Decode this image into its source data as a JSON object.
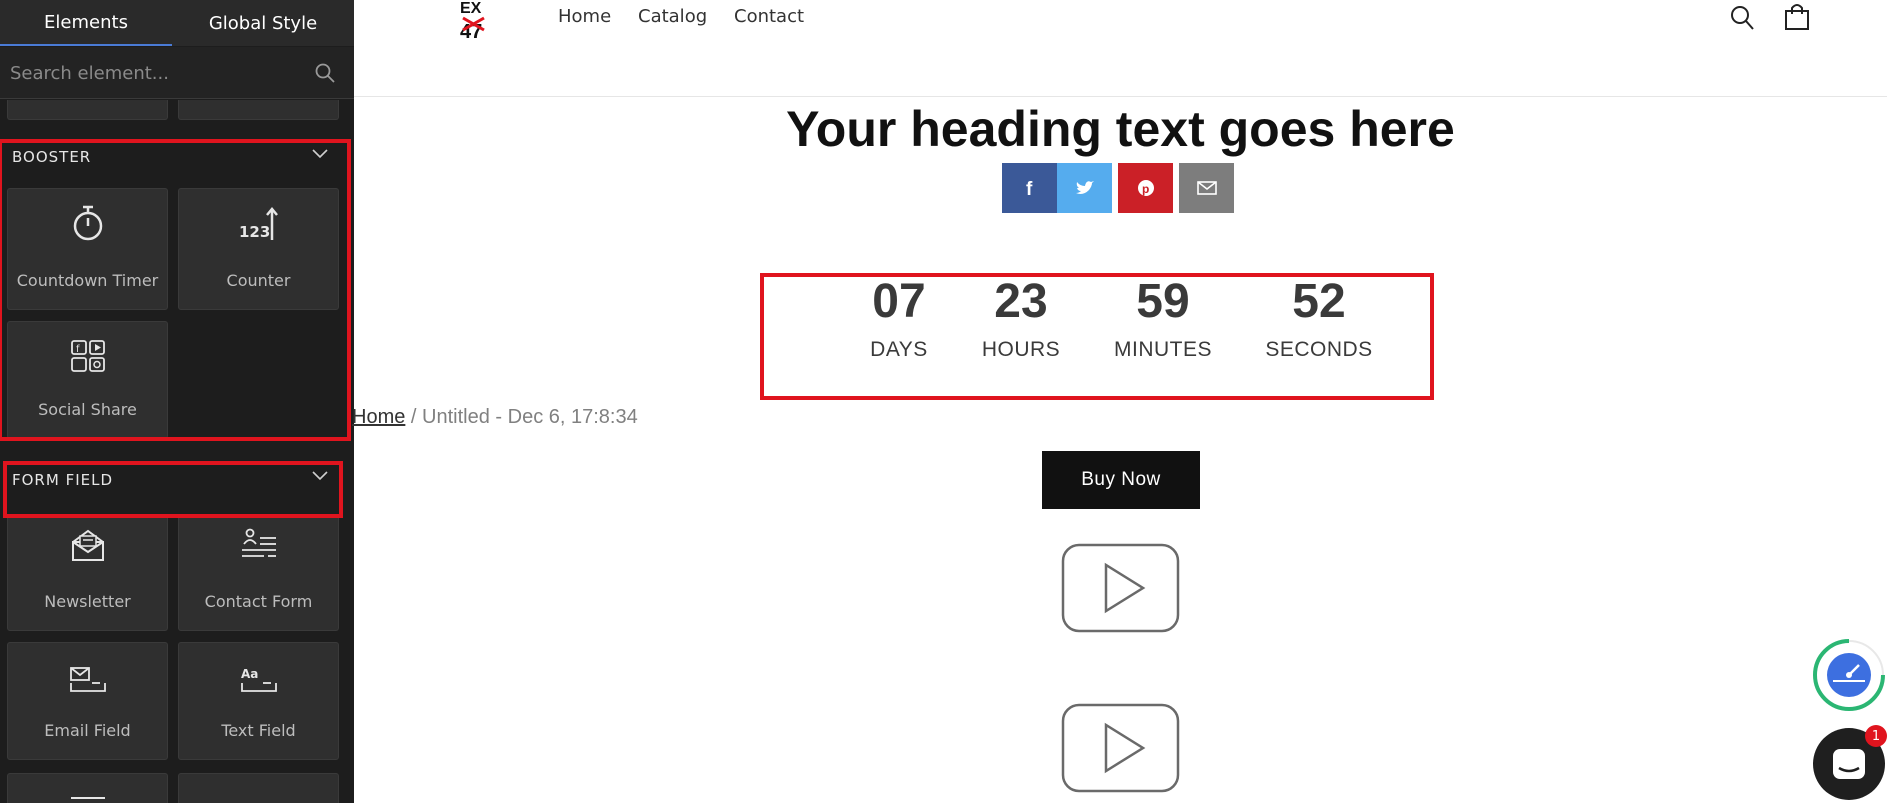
{
  "sidebar": {
    "tabs": [
      {
        "label": "Elements",
        "active": true
      },
      {
        "label": "Global Style",
        "active": false
      }
    ],
    "search": {
      "placeholder": "Search element..."
    },
    "sections": {
      "booster": {
        "title": "BOOSTER",
        "items": [
          {
            "label": "Countdown Timer",
            "icon": "stopwatch-icon"
          },
          {
            "label": "Counter",
            "icon": "counter-123-icon"
          },
          {
            "label": "Social Share",
            "icon": "social-share-icon"
          }
        ]
      },
      "form_field": {
        "title": "FORM FIELD",
        "items": [
          {
            "label": "Newsletter",
            "icon": "newsletter-icon"
          },
          {
            "label": "Contact Form",
            "icon": "contact-form-icon"
          },
          {
            "label": "Email Field",
            "icon": "email-field-icon"
          },
          {
            "label": "Text Field",
            "icon": "text-field-icon"
          }
        ]
      }
    }
  },
  "header": {
    "logo_text": "EX 47",
    "nav": [
      "Home",
      "Catalog",
      "Contact"
    ],
    "icons": [
      "search-icon",
      "cart-icon"
    ]
  },
  "page": {
    "heading": "Your heading text goes here",
    "share_buttons": [
      {
        "network": "facebook",
        "icon": "facebook-icon",
        "color": "#3b5998"
      },
      {
        "network": "twitter",
        "icon": "twitter-icon",
        "color": "#55acee"
      },
      {
        "network": "pinterest",
        "icon": "pinterest-icon",
        "color": "#cb2027"
      },
      {
        "network": "email",
        "icon": "mail-icon",
        "color": "#7d7d7d"
      }
    ],
    "countdown": {
      "days": "07",
      "days_label": "DAYS",
      "hours": "23",
      "hours_label": "HOURS",
      "minutes": "59",
      "minutes_label": "MINUTES",
      "seconds": "52",
      "seconds_label": "SECONDS"
    },
    "breadcrumb": {
      "home": "Home",
      "separator": "/",
      "current": "Untitled - Dec 6, 17:8:34"
    },
    "buy_button": "Buy Now",
    "widgets": {
      "chat_badge": "1"
    }
  },
  "colors": {
    "highlight": "#e0141e",
    "sidebar_bg": "#1d1d1d",
    "card_bg": "#2f2f2f"
  }
}
